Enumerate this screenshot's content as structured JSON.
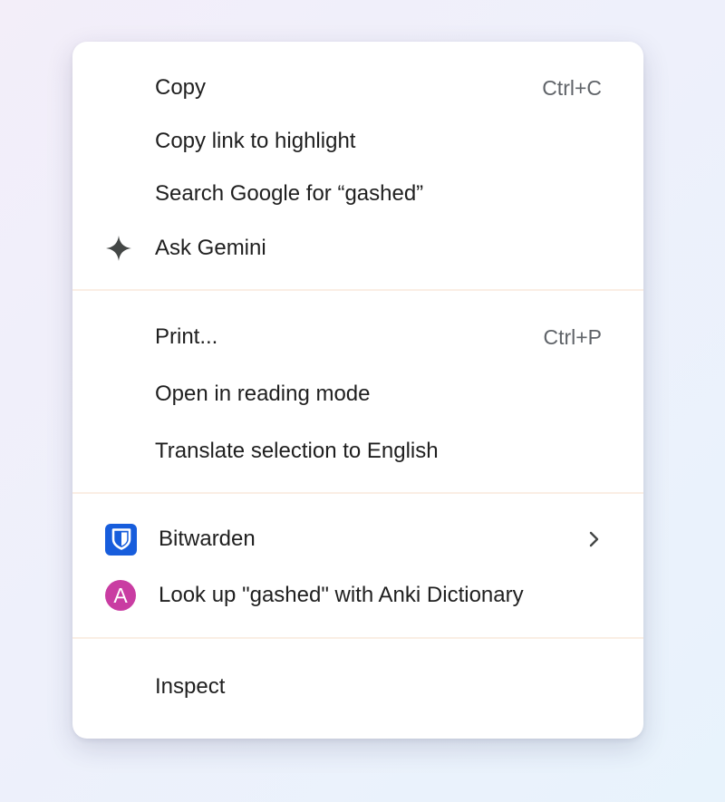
{
  "context_menu": {
    "groups": [
      {
        "items": [
          {
            "label": "Copy",
            "shortcut": "Ctrl+C"
          },
          {
            "label": "Copy link to highlight"
          },
          {
            "label": "Search Google for “gashed”"
          },
          {
            "label": "Ask Gemini",
            "icon": "gemini-sparkle-icon"
          }
        ]
      },
      {
        "items": [
          {
            "label": "Print...",
            "shortcut": "Ctrl+P"
          },
          {
            "label": "Open in reading mode"
          },
          {
            "label": "Translate selection to English"
          }
        ]
      },
      {
        "items": [
          {
            "label": "Bitwarden",
            "icon": "bitwarden-shield-icon",
            "submenu_icon": "chevron-right-icon"
          },
          {
            "label": "Look up \"gashed\" with Anki Dictionary",
            "icon": "anki-dictionary-icon",
            "icon_letter": "A"
          }
        ]
      },
      {
        "items": [
          {
            "label": "Inspect"
          }
        ]
      }
    ]
  },
  "colors": {
    "text": "#1f1f1f",
    "shortcut_text": "#5f6368",
    "separator": "#faeee4",
    "bitwarden_blue": "#175ddc",
    "anki_magenta": "#c93ca2",
    "gemini_icon": "#444746"
  }
}
